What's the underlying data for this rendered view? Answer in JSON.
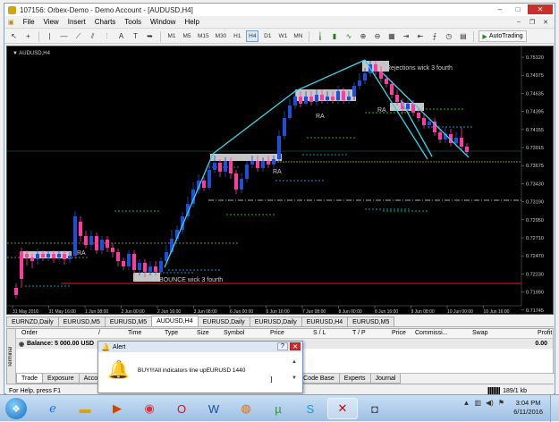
{
  "window": {
    "title": "107156: Orbex-Demo - Demo Account - [AUDUSD,H4]",
    "controls": {
      "minimize": "–",
      "maximize": "□",
      "close": "✕"
    }
  },
  "menu": [
    "File",
    "View",
    "Insert",
    "Charts",
    "Tools",
    "Window",
    "Help"
  ],
  "toolbar": {
    "timeframes": [
      "M1",
      "M5",
      "M15",
      "M30",
      "H1",
      "H4",
      "D1",
      "W1",
      "MN"
    ],
    "active_timeframe": "H4",
    "autotrading_label": "AutoTrading"
  },
  "chart": {
    "symbol_label": "AUDUSD,H4",
    "price_labels": [
      "0.75120",
      "0.74975",
      "0.74635",
      "0.74395",
      "0.74155",
      "0.73915",
      "0.73675",
      "0.73430",
      "0.73190",
      "0.72950",
      "0.72710",
      "0.72470",
      "0.72230",
      "0.71990",
      "0.71745"
    ],
    "time_labels": [
      "31 May 2016",
      "31 May 16:00",
      "1 Jun 08:00",
      "2 Jun 00:00",
      "2 Jun 16:00",
      "3 Jun 08:00",
      "6 Jun 00:00",
      "6 Jun 16:00",
      "7 Jun 08:00",
      "8 Jun 00:00",
      "8 Jun 16:00",
      "9 Jun 08:00",
      "10 Jun 00:00",
      "10 Jun 16:00"
    ],
    "annotations": {
      "rejections": "Rejections  wick 3 fourth",
      "bounce": "BOUNCE  wick 3 fourth",
      "ra": "RA"
    },
    "colors": {
      "bull": "#1f4fd6",
      "bear": "#ff3aa0",
      "trend": "#35d6e8",
      "zone": "#e8e8e8",
      "support": "#e02020",
      "dash_green": "#00ff00",
      "dash_cyan": "#00c8ff"
    }
  },
  "chart_tabs": [
    "EURNZD,Daily",
    "EURUSD,M5",
    "EURUSD,M5",
    "AUDUSD,H4",
    "EURUSD,Daily",
    "EURUSD,Daily",
    "EURUSD,H4",
    "EURUSD,M5"
  ],
  "active_chart_tab": "AUDUSD,H4",
  "terminal": {
    "side_label": "Terminal",
    "columns": [
      "Order",
      "/",
      "Time",
      "Type",
      "Size",
      "Symbol",
      "Price",
      "S / L",
      "T / P",
      "Price",
      "Commissi...",
      "Swap",
      "Profit"
    ],
    "balance_label": "Balance: 5 000.00 USD",
    "balance_value": "0.00",
    "tabs": [
      "Trade",
      "Exposure",
      "Acco",
      "Signals",
      "Code Base",
      "Experts",
      "Journal"
    ],
    "active_tab": "Trade"
  },
  "alert": {
    "title": "Alert",
    "message": "BUY!!!All indicators line upEURUSD 1440",
    "help_btn": "?",
    "close_btn": "✕"
  },
  "status": {
    "help_text": "For Help, press F1",
    "traffic": "189/1 kb"
  },
  "taskbar": {
    "apps": [
      "ie-icon",
      "explorer-icon",
      "media-icon",
      "chrome-icon",
      "opera-icon",
      "word-icon",
      "firefox-icon",
      "utorrent-icon",
      "skype-icon",
      "metatrader-icon",
      "camera-icon"
    ],
    "time": "3:04 PM",
    "date": "6/11/2016"
  }
}
